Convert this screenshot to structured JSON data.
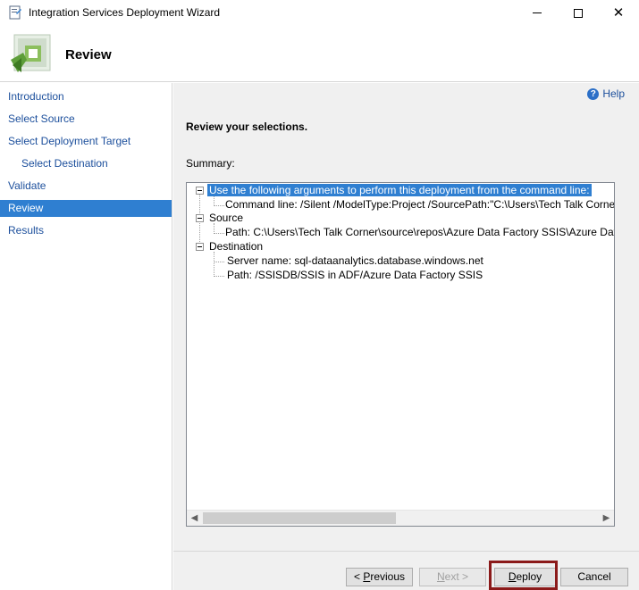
{
  "window": {
    "title": "Integration Services Deployment Wizard",
    "icons": {
      "app": "ssis-wizard-icon",
      "minimize": "minimize-icon",
      "maximize": "maximize-icon",
      "close": "close-icon"
    }
  },
  "header": {
    "title": "Review",
    "graphic": "wizard-graphic-icon"
  },
  "nav": {
    "items": [
      {
        "label": "Introduction",
        "active": false
      },
      {
        "label": "Select Source",
        "active": false
      },
      {
        "label": "Select Deployment Target",
        "active": false
      },
      {
        "label": "Select Destination",
        "active": false
      },
      {
        "label": "Validate",
        "active": false
      },
      {
        "label": "Review",
        "active": true
      },
      {
        "label": "Results",
        "active": false
      }
    ],
    "colors": {
      "link": "#1c4f9c",
      "active_bg": "#2f7fd1"
    }
  },
  "content": {
    "help_label": "Help",
    "heading": "Review your selections.",
    "summary_label": "Summary:",
    "tree": {
      "arguments_header": "Use the following arguments to perform this deployment from the command line:",
      "command_line": "Command line: /Silent /ModelType:Project /SourcePath:\"C:\\Users\\Tech Talk Corner\\sourc",
      "source_header": "Source",
      "source_path": "Path: C:\\Users\\Tech Talk Corner\\source\\repos\\Azure Data Factory SSIS\\Azure Data Facto",
      "destination_header": "Destination",
      "server_name": "Server name: sql-dataanalytics.database.windows.net",
      "destination_path": "Path: /SSISDB/SSIS in ADF/Azure Data Factory SSIS"
    }
  },
  "buttons": {
    "previous_prefix": "< ",
    "previous_u": "P",
    "previous_rest": "revious",
    "next_u": "N",
    "next_rest": "ext >",
    "deploy_u": "D",
    "deploy_rest": "eploy",
    "cancel": "Cancel",
    "highlight_color": "#8b1a1a"
  }
}
